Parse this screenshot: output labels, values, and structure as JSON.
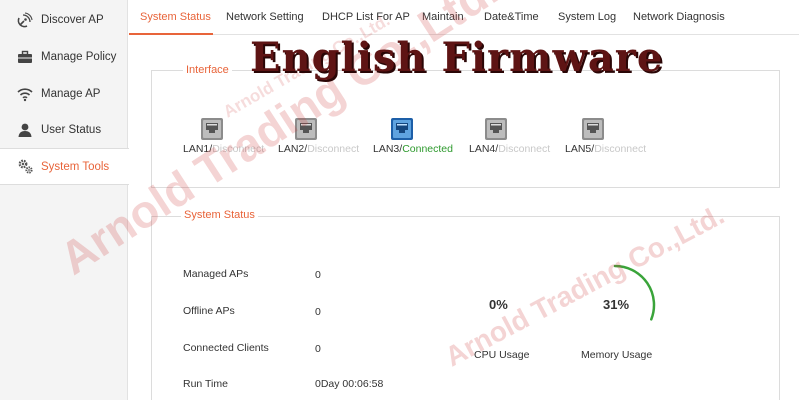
{
  "sidebar": {
    "items": [
      {
        "label": "Discover AP",
        "icon": "satellite-dish-icon",
        "active": false
      },
      {
        "label": "Manage Policy",
        "icon": "briefcase-icon",
        "active": false
      },
      {
        "label": "Manage AP",
        "icon": "wifi-icon",
        "active": false
      },
      {
        "label": "User Status",
        "icon": "user-icon",
        "active": false
      },
      {
        "label": "System Tools",
        "icon": "gears-icon",
        "active": true
      }
    ]
  },
  "tabs": [
    {
      "label": "System Status",
      "active": true
    },
    {
      "label": "Network Setting",
      "active": false
    },
    {
      "label": "DHCP List For AP",
      "active": false
    },
    {
      "label": "Maintain",
      "active": false
    },
    {
      "label": "Date&Time",
      "active": false
    },
    {
      "label": "System Log",
      "active": false
    },
    {
      "label": "Network Diagnosis",
      "active": false
    }
  ],
  "interface": {
    "title": "Interface",
    "ports": [
      {
        "name": "LAN1/",
        "status": "Disconnect",
        "connected": false
      },
      {
        "name": "LAN2/",
        "status": "Disconnect",
        "connected": false
      },
      {
        "name": "LAN3/",
        "status": "Connected",
        "connected": true
      },
      {
        "name": "LAN4/",
        "status": "Disconnect",
        "connected": false
      },
      {
        "name": "LAN5/",
        "status": "Disconnect",
        "connected": false
      }
    ]
  },
  "system_status": {
    "title": "System Status",
    "rows": [
      {
        "label": "Managed APs",
        "value": "0"
      },
      {
        "label": "Offline APs",
        "value": "0"
      },
      {
        "label": "Connected Clients",
        "value": "0"
      },
      {
        "label": "Run Time",
        "value": "0Day 00:06:58"
      }
    ],
    "cpu": {
      "value_text": "0%",
      "label": "CPU Usage",
      "fraction": 0.0
    },
    "memory": {
      "value_text": "31%",
      "label": "Memory Usage",
      "fraction": 0.31
    }
  },
  "overlay": {
    "banner": "English Firmware",
    "watermark": "Arnold Trading Co.,Ltd."
  },
  "colors": {
    "accent": "#e8643a",
    "connected": "#2e9a2e",
    "disconnected": "#c8c8c8",
    "gauge": "#3aa43a",
    "banner": "#5e1414"
  }
}
